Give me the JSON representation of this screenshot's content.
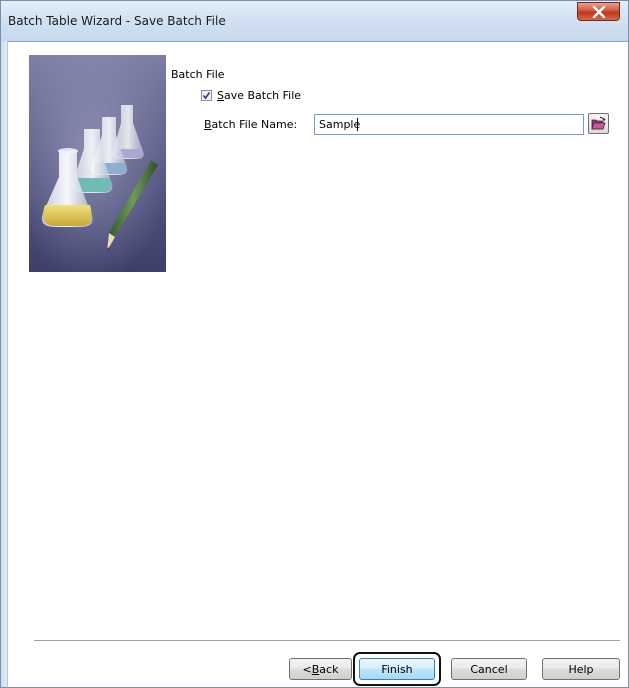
{
  "window": {
    "title": "Batch Table Wizard - Save Batch File"
  },
  "batch_file": {
    "group_label": "Batch File",
    "save_checkbox": {
      "label_mnemonic": "S",
      "label_rest": "ave Batch File",
      "checked": true
    },
    "file_name": {
      "label_mnemonic": "B",
      "label_rest": "atch File Name:",
      "value": "Sample"
    }
  },
  "buttons": {
    "back_prefix": "< ",
    "back_mnemonic": "B",
    "back_rest": "ack",
    "finish": "Finish",
    "cancel": "Cancel",
    "help": "Help"
  },
  "icons": {
    "close": "close-icon",
    "browse": "open-folder-icon",
    "illustration": "flasks-pencil-illustration"
  },
  "colors": {
    "titlebar": "#d3e2f3",
    "close": "#c0351b",
    "illustration_bg": "#4b4d79"
  }
}
